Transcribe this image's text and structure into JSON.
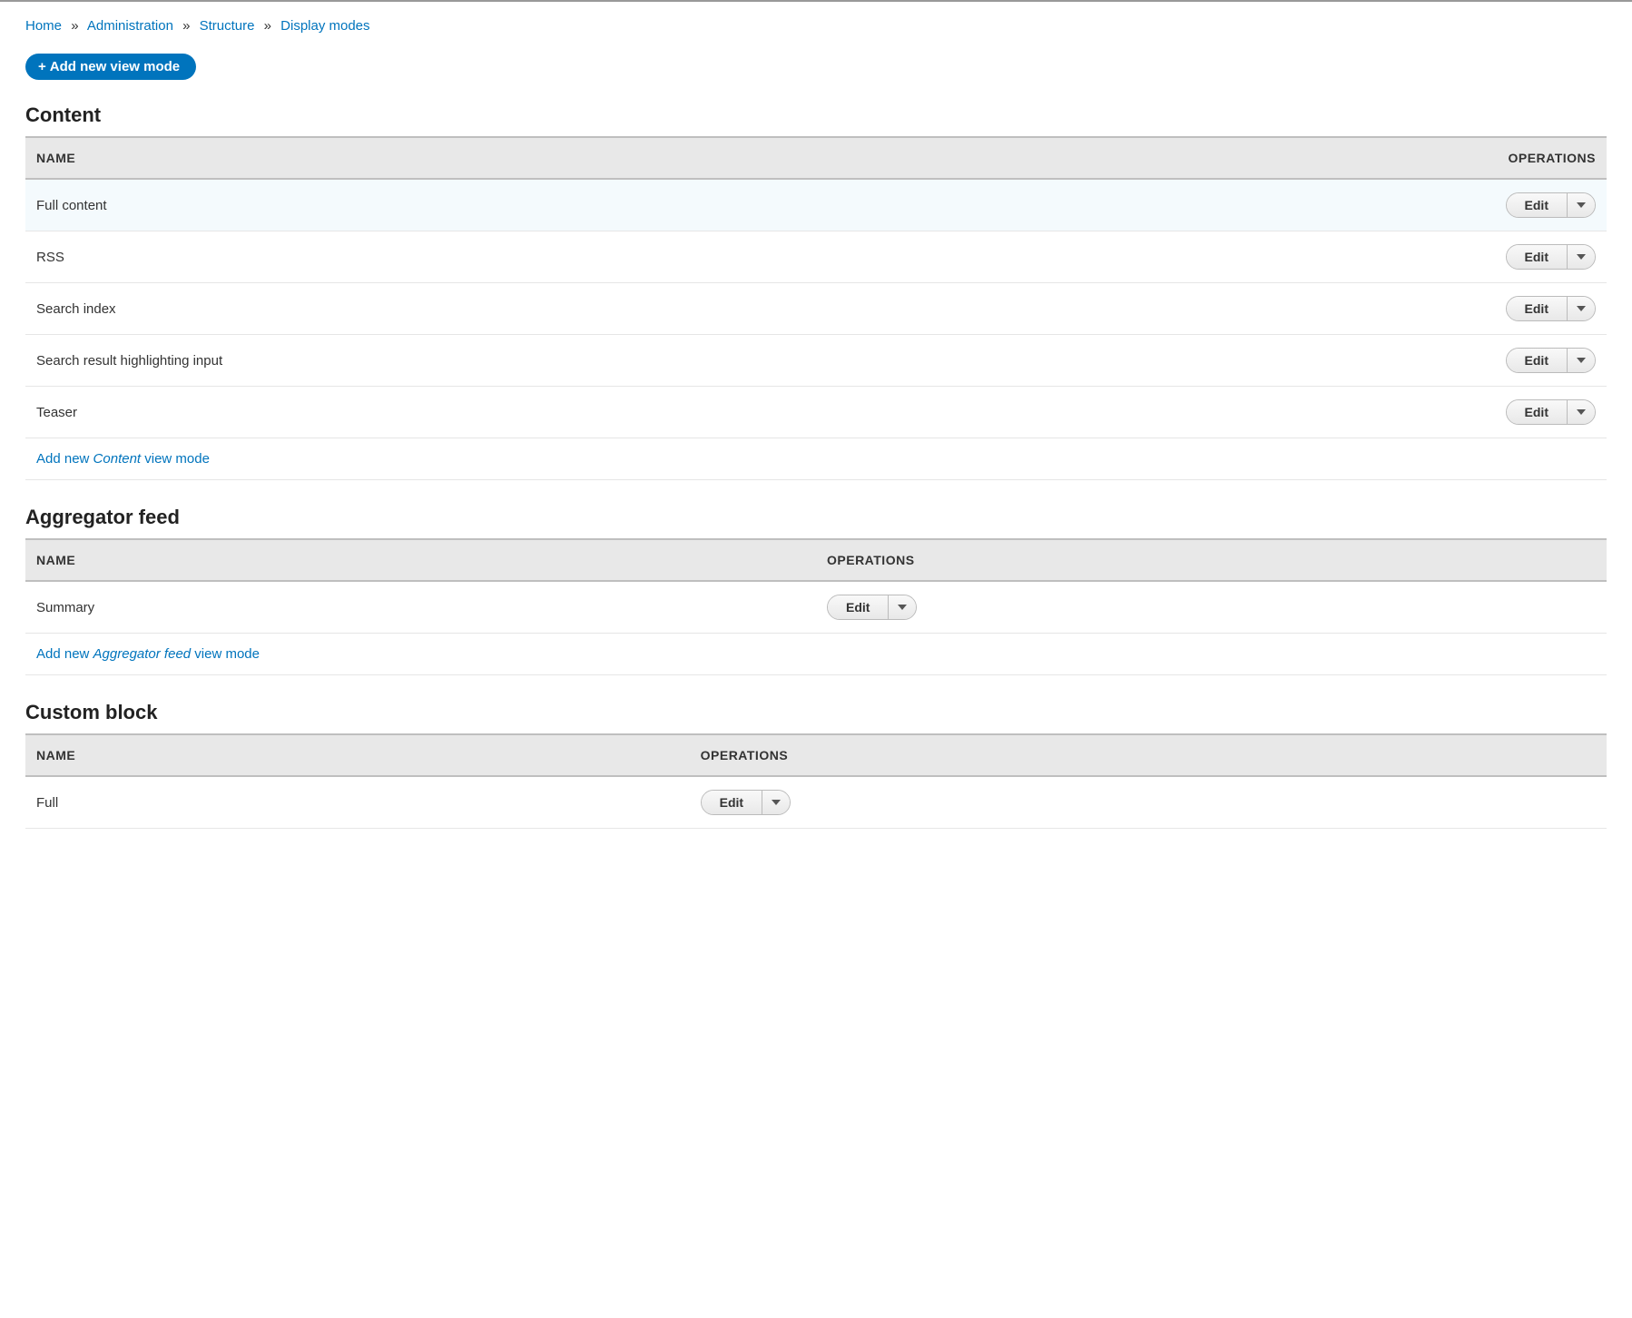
{
  "breadcrumb": {
    "home": "Home",
    "administration": "Administration",
    "structure": "Structure",
    "display_modes": "Display modes",
    "sep": "»"
  },
  "add_button": {
    "plus": "+",
    "label": "Add new view mode"
  },
  "columns": {
    "name": "NAME",
    "operations": "OPERATIONS"
  },
  "edit_label": "Edit",
  "add_new_prefix": "Add new ",
  "add_new_suffix": " view mode",
  "sections": {
    "content": {
      "title": "Content",
      "entity": "Content",
      "rows": [
        {
          "name": "Full content"
        },
        {
          "name": "RSS"
        },
        {
          "name": "Search index"
        },
        {
          "name": "Search result highlighting input"
        },
        {
          "name": "Teaser"
        }
      ]
    },
    "aggregator": {
      "title": "Aggregator feed",
      "entity": "Aggregator feed",
      "rows": [
        {
          "name": "Summary"
        }
      ]
    },
    "custom_block": {
      "title": "Custom block",
      "entity": "Custom block",
      "rows": [
        {
          "name": "Full"
        }
      ]
    }
  }
}
